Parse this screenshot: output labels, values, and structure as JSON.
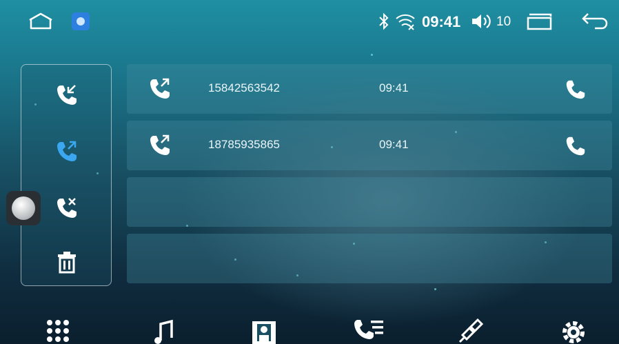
{
  "status_bar": {
    "time": "09:41",
    "volume": "10",
    "icons": [
      "home-icon",
      "app-badge-icon",
      "bluetooth-icon",
      "wifi-icon",
      "volume-icon",
      "recent-apps-icon",
      "back-icon"
    ]
  },
  "call_tabs": [
    {
      "name": "incoming-calls",
      "icon": "incoming-call-icon",
      "active": false
    },
    {
      "name": "outgoing-calls",
      "icon": "outgoing-call-icon",
      "active": true
    },
    {
      "name": "missed-calls",
      "icon": "missed-call-icon",
      "active": false
    },
    {
      "name": "delete",
      "icon": "trash-icon",
      "active": false
    }
  ],
  "call_log": [
    {
      "number": "15842563542",
      "time": "09:41",
      "direction": "outgoing"
    },
    {
      "number": "18785935865",
      "time": "09:41",
      "direction": "outgoing"
    }
  ],
  "bottom_nav": [
    "apps-grid-icon",
    "music-icon",
    "contacts-icon",
    "call-log-icon",
    "link-icon",
    "settings-icon"
  ],
  "colors": {
    "accent": "#3ba7f0",
    "text": "#ffffff"
  }
}
